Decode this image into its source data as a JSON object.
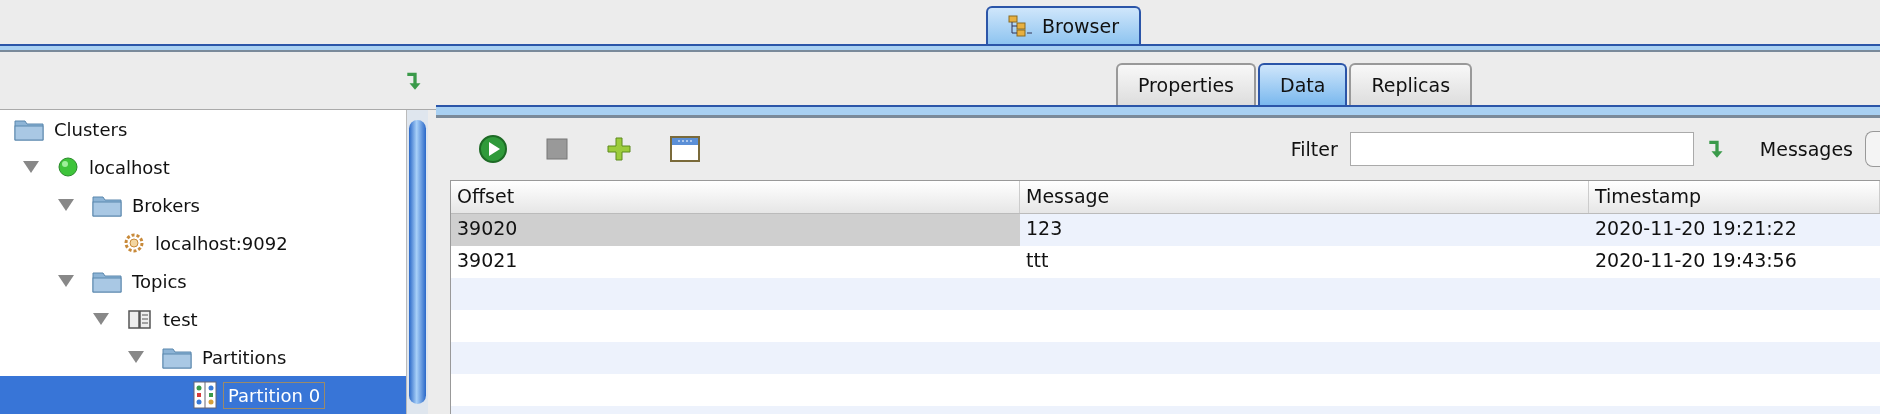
{
  "window_tab": {
    "label": "Browser",
    "selected": true
  },
  "tree": [
    {
      "label": "Clusters",
      "kind": "folder",
      "selected": false,
      "children": [
        {
          "label": "localhost",
          "kind": "server",
          "expanded": true,
          "selected": false,
          "children": [
            {
              "label": "Brokers",
              "kind": "folder",
              "expanded": true,
              "selected": false,
              "children": [
                {
                  "label": "localhost:9092",
                  "kind": "broker",
                  "selected": false
                }
              ]
            },
            {
              "label": "Topics",
              "kind": "folder",
              "expanded": true,
              "selected": false,
              "children": [
                {
                  "label": "test",
                  "kind": "topic",
                  "expanded": true,
                  "selected": false,
                  "children": [
                    {
                      "label": "Partitions",
                      "kind": "folder",
                      "expanded": true,
                      "selected": false,
                      "children": [
                        {
                          "label": "Partition 0",
                          "kind": "partition",
                          "selected": true
                        }
                      ]
                    }
                  ]
                }
              ]
            }
          ]
        }
      ]
    }
  ],
  "tabs": [
    {
      "label": "Properties",
      "selected": false
    },
    {
      "label": "Data",
      "selected": true
    },
    {
      "label": "Replicas",
      "selected": false
    }
  ],
  "filter": {
    "label": "Filter"
  },
  "messages_label": "Messages",
  "table": {
    "columns": [
      "Offset",
      "Message",
      "Timestamp"
    ],
    "rows": [
      {
        "cells": [
          "39020",
          "123",
          "2020-11-20 19:21:22"
        ],
        "selected": true
      },
      {
        "cells": [
          "39021",
          "ttt",
          "2020-11-20 19:43:56"
        ],
        "selected": false
      }
    ]
  }
}
